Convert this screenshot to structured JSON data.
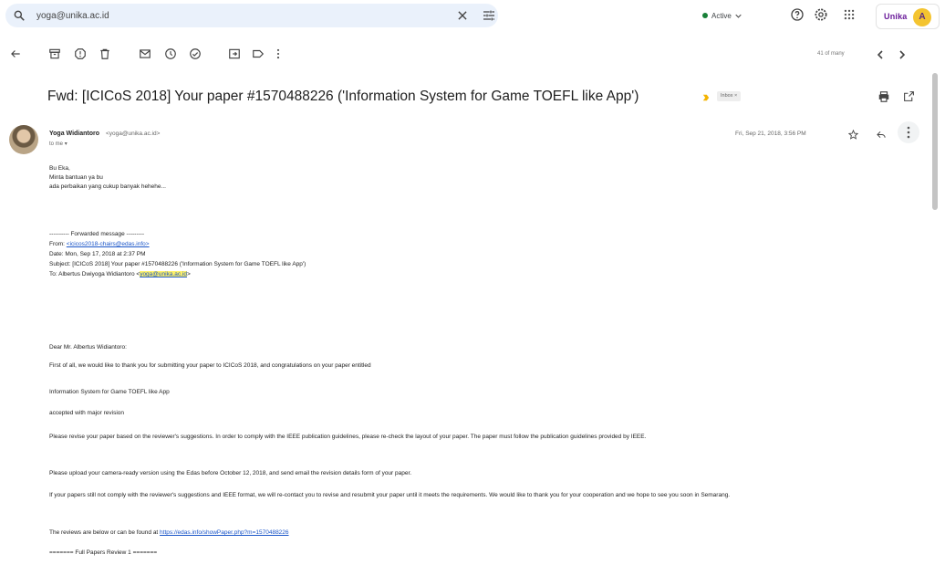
{
  "search": {
    "value": "yoga@unika.ac.id"
  },
  "header": {
    "status": "Active",
    "brand": "Unika",
    "avatar_letter": "A"
  },
  "toolbar": {
    "page_count": "41 of many"
  },
  "email": {
    "subject": "Fwd: [ICICoS 2018] Your paper #1570488226 ('Information System for Game TOEFL like App')",
    "label": "Inbox",
    "sender_name": "Yoga Widiantoro",
    "sender_email": "<yoga@unika.ac.id>",
    "to": "to me",
    "date": "Fri, Sep 21, 2018, 3:56 PM",
    "intro": [
      "Bu Eka,",
      "Minta bantuan ya bu",
      "ada perbaikan yang cukup banyak hehehe..."
    ],
    "forwarded": {
      "header": "---------- Forwarded message ---------",
      "from_label": "From:",
      "from_email": "<icicos2018-chairs@edas.info>",
      "date_line": "Date: Mon, Sep 17, 2018 at 2:37 PM",
      "subject_line": "Subject: [ICICoS 2018] Your paper #1570488226 ('Information System for Game TOEFL like App')",
      "to_label": "To: Albertus Dwiyoga Widiantoro <",
      "to_email": "yoga@unika.ac.id",
      "to_close": ">"
    },
    "greeting": "Dear Mr. Albertus Widiantoro:",
    "p1": "First of all, we would like to thank you for submitting your paper to ICICoS 2018, and congratulations on your paper entitled",
    "p2": "Information System for Game TOEFL like App",
    "p3": "accepted with major revision",
    "p4": "Please revise your paper based on the reviewer's suggestions. In order to comply with the IEEE publication guidelines, please re-check the layout of your paper. The paper must follow the publication guidelines provided by IEEE.",
    "p5": "Please upload your camera-ready version using the Edas before October 12, 2018, and send email the revision details form of your paper.",
    "p6": "If your papers still not comply with the reviewer's suggestions and IEEE format, we will re-contact you to revise and resubmit your paper until it meets the requirements. We would like to thank you for your cooperation and we hope to see you soon in Semarang.",
    "p7_text": "The reviews are below or can be found at ",
    "p7_link": "https://edas.info/showPaper.php?m=1570488226",
    "p8": "======= Full Papers Review 1 ======="
  }
}
